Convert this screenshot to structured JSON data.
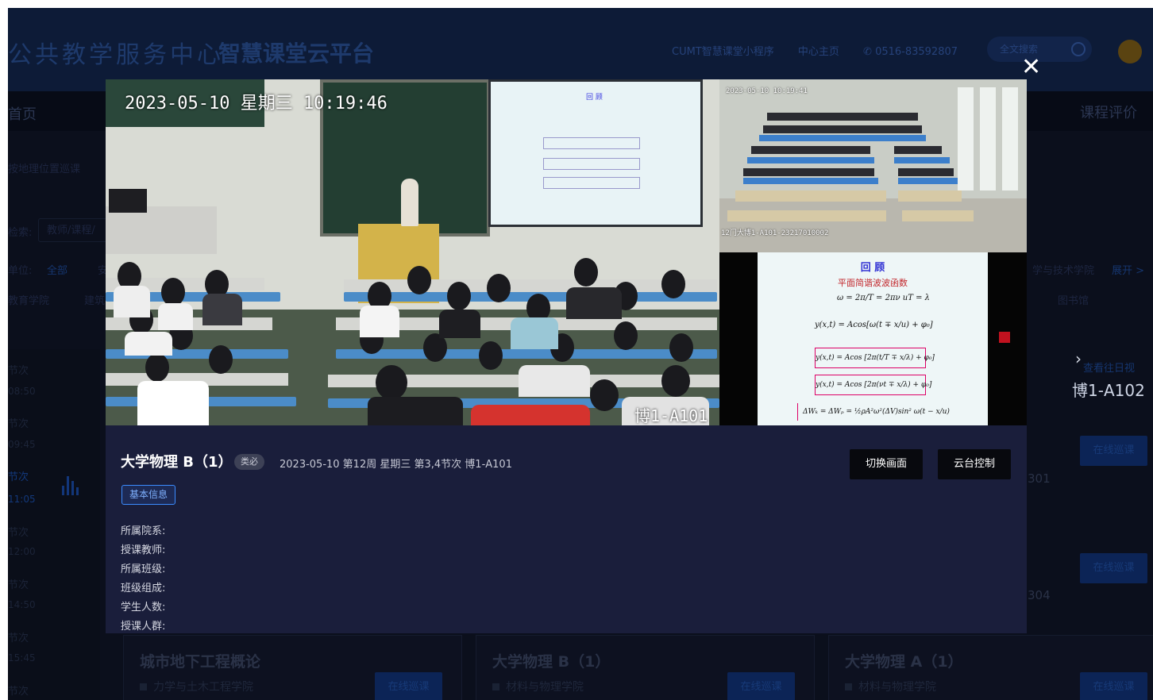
{
  "header": {
    "brand_left": "公共教学服务中心",
    "brand_right": "智慧课堂云平台",
    "links": [
      "CUMT智慧课堂小程序",
      "中心主页",
      "✆ 0516-83592807"
    ],
    "search_placeholder": "全文搜索"
  },
  "nav": {
    "home": "首页",
    "evaluation": "课程评价"
  },
  "background": {
    "by_location": "按地理位置巡课",
    "search_label": "检索:",
    "search_placeholder": "教师/课程/",
    "unit_label": "单位:",
    "unit_all": "全部",
    "unit_partial": "安",
    "college_right": "学与技术学院",
    "expand": "展开 >",
    "edu_college": "教育学院",
    "build": "建筑",
    "library": "图书馆",
    "slots": [
      {
        "label": "节次",
        "time": "08:50"
      },
      {
        "label": "节次",
        "time": "09:45"
      },
      {
        "label": "节次",
        "time": "11:05"
      },
      {
        "label": "节次",
        "time": "12:00"
      },
      {
        "label": "节次",
        "time": "14:50"
      },
      {
        "label": "节次",
        "time": "15:45"
      },
      {
        "label": "节次",
        "time": ""
      }
    ],
    "history_link": "查看往日视",
    "room_right": "博1-A102",
    "inspect_btn": "在线巡课",
    "room_num_1": "301",
    "room_num_2": "304",
    "cards": [
      {
        "title": "城市地下工程概论",
        "college": "力学与土木工程学院",
        "btn": "在线巡课"
      },
      {
        "title": "大学物理 B（1）",
        "college": "材料与物理学院",
        "btn": "在线巡课"
      },
      {
        "title": "大学物理 A（1）",
        "college": "材料与物理学院",
        "btn": "在线巡课"
      }
    ]
  },
  "modal": {
    "close_symbol": "✕",
    "video_timestamp": "2023-05-10 星期三 10:19:46",
    "video_room": "博1-A101",
    "cam2_timestamp": "2023-05-10 10:19:41",
    "cam2_caption": "12门大博1-A101-23217010002",
    "slide": {
      "title": "回 顾",
      "subtitle": "平面简谐波波函数",
      "eq1": "ω = 2π/T = 2πν    uT = λ",
      "eq2": "y(x,t) = Acos[ω(t ∓ x/u) + φ₀]",
      "eq3": "y(x,t) = Acos [2π(t/T ∓ x/λ) + φ₀]",
      "eq4": "y(x,t) = Acos [2π(νt ∓ x/λ) + φ₀]",
      "eq5": "ΔWₖ = ΔWₚ = ½ρA²ω²(ΔV)sin² ω(t − x/u)"
    },
    "course_title": "大学物理 B（1）",
    "tag": "类必",
    "meta": "2023-05-10 第12周 星期三 第3,4节次 博1-A101",
    "btn_switch": "切换画面",
    "btn_ptz": "云台控制",
    "info_tab": "基本信息",
    "info": [
      {
        "label": "所属院系:",
        "value": ""
      },
      {
        "label": "授课教师:",
        "value": ""
      },
      {
        "label": "所属班级:",
        "value": ""
      },
      {
        "label": "班级组成:",
        "value": ""
      },
      {
        "label": "学生人数:",
        "value": ""
      },
      {
        "label": "授课人群:",
        "value": ""
      }
    ]
  },
  "colors": {
    "modal_bg": "#1a1e3b",
    "accent_blue": "#3b8cff",
    "overlay_dark": "#0b0f1c"
  }
}
